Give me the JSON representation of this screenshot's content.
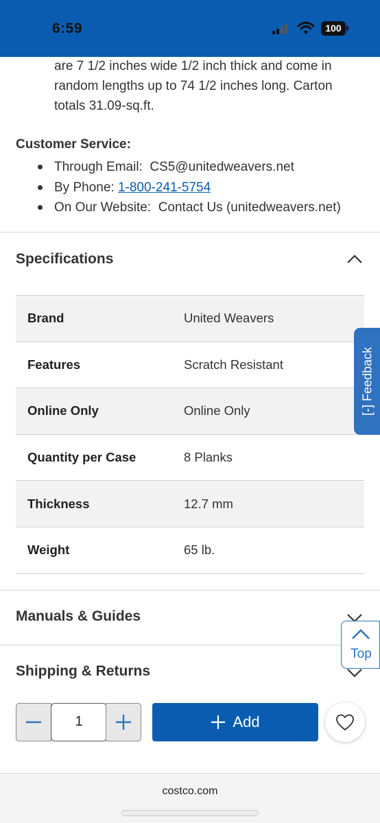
{
  "status_bar": {
    "time": "6:59",
    "battery": "100",
    "color": "#0a5cb1"
  },
  "description": {
    "lines": [
      "are 7 1/2 inches wide 1/2 inch thick and come in",
      "random lengths up to 74 1/2 inches long. Carton",
      "totals 31.09-sq.ft."
    ]
  },
  "customer_service": {
    "title": "Customer Service:",
    "email_prefix": "Through Email:  ",
    "email": "CS5@unitedweavers.net",
    "phone_prefix": "By Phone: ",
    "phone": "1-800-241-5754",
    "website_prefix": "On Our Website:  ",
    "website": "Contact Us (unitedweavers.net)"
  },
  "specifications": {
    "title": "Specifications",
    "rows": [
      {
        "key": "Brand",
        "value": "United Weavers"
      },
      {
        "key": "Features",
        "value": "Scratch Resistant"
      },
      {
        "key": "Online Only",
        "value": "Online Only"
      },
      {
        "key": "Quantity per Case",
        "value": "8 Planks"
      },
      {
        "key": "Thickness",
        "value": "12.7 mm"
      },
      {
        "key": "Weight",
        "value": "65 lb."
      }
    ]
  },
  "sections": {
    "manuals": "Manuals & Guides",
    "shipping": "Shipping & Returns"
  },
  "feedback": {
    "label": "[-] Feedback"
  },
  "top_button": {
    "label": "Top"
  },
  "cart": {
    "quantity": "1",
    "add_label": "Add"
  },
  "browser": {
    "domain": "costco.com"
  },
  "colors": {
    "brand_blue": "#0a5cb1",
    "accent_blue": "#2f72bf"
  }
}
